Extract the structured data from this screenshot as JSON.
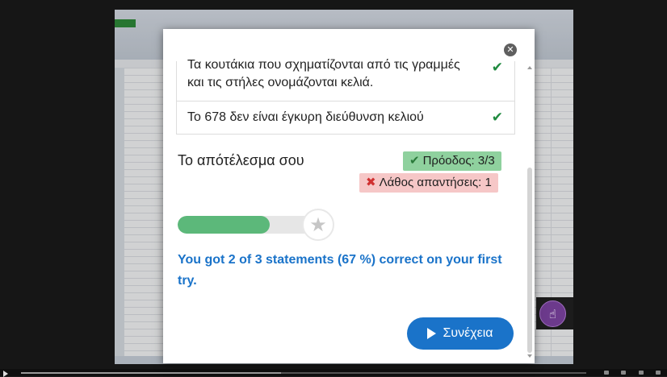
{
  "statements": [
    {
      "text": "Τα κουτάκια που σχηματίζονται από τις γραμμές και τις στήλες ονομάζονται κελιά.",
      "icon": "check-icon"
    },
    {
      "text": "Το 678 δεν είναι έγκυρη διεύθυνση κελιού",
      "icon": "check-icon"
    }
  ],
  "result": {
    "title": "Το απότέλεσμα σου",
    "progress_label": "Πρόοδος: 3/3",
    "wrong_label": "Λάθος απαντήσεις: 1",
    "score_fraction": 0.67,
    "feedback": "You got 2 of 3 statements (67 %) correct on your first try."
  },
  "continue_label": "Συνέχεια",
  "colors": {
    "accent": "#1a73c9",
    "success": "#5cb87a",
    "success_badge": "#8fd19e",
    "error_badge": "#f6c7c7",
    "hotspot": "#6c3a8c"
  },
  "icons": {
    "close": "close-icon",
    "check": "check-icon",
    "cross": "cross-icon",
    "star": "star-icon",
    "play": "play-icon",
    "hand": "hand-pointer-icon"
  }
}
